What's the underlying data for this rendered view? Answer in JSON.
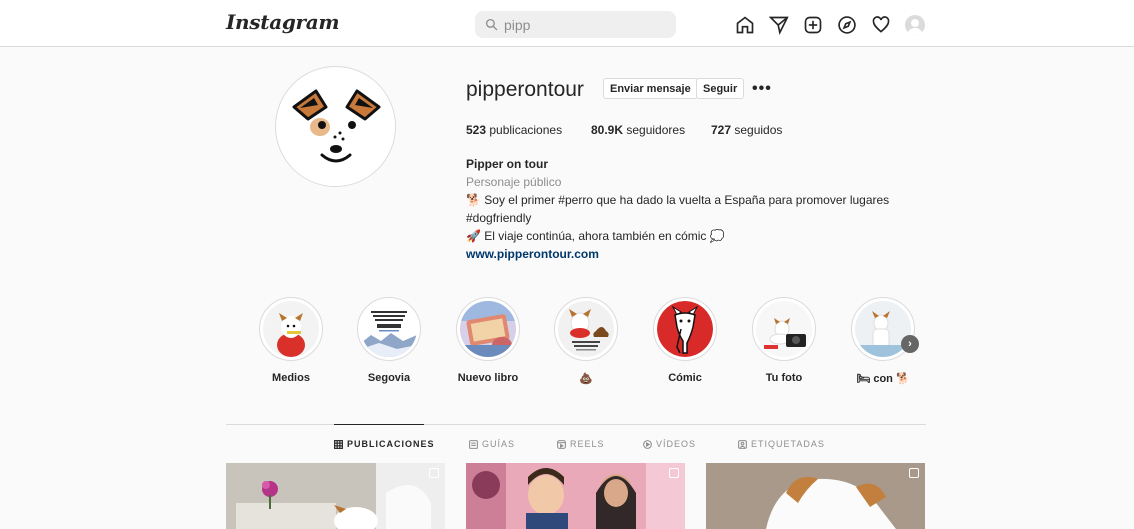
{
  "topbar": {
    "logo": "Instagram",
    "search_value": "pipp",
    "icons": [
      "home-icon",
      "direct-icon",
      "new-post-icon",
      "explore-icon",
      "activity-icon",
      "profile-avatar"
    ]
  },
  "profile": {
    "username": "pipperontour",
    "message_button": "Enviar mensaje",
    "follow_button": "Seguir",
    "more_label": "•••",
    "stats": {
      "posts_count": "523",
      "posts_label": " publicaciones",
      "followers_count": "80.9K",
      "followers_label": " seguidores",
      "following_count": "727",
      "following_label": " seguidos"
    },
    "bio": {
      "name": "Pipper on tour",
      "category": "Personaje público",
      "line1": "🐕 Soy el primer #perro que ha dado la vuelta a España para promover lugares",
      "line2": "#dogfriendly",
      "line3": "🚀 El viaje continúa, ahora también en cómic 💭",
      "link": "www.pipperontour.com"
    }
  },
  "highlights": [
    {
      "label": "Medios"
    },
    {
      "label": "Segovia"
    },
    {
      "label": "Nuevo libro"
    },
    {
      "label": "💩"
    },
    {
      "label": "Cómic"
    },
    {
      "label": "Tu foto"
    },
    {
      "label": "🛏 con 🐕"
    }
  ],
  "tabs": [
    {
      "label": "PUBLICACIONES",
      "active": true
    },
    {
      "label": "GUÍAS",
      "active": false
    },
    {
      "label": "REELS",
      "active": false
    },
    {
      "label": "VÍDEOS",
      "active": false
    },
    {
      "label": "ETIQUETADAS",
      "active": false
    }
  ],
  "colors": {
    "link": "#00376b",
    "border": "#dbdbdb",
    "muted": "#8e8e8e"
  }
}
